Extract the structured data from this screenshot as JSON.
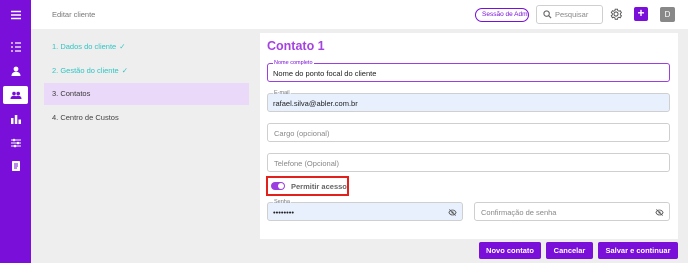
{
  "rail": {
    "items": [
      {
        "icon": "menu-icon"
      },
      {
        "icon": "list-icon"
      },
      {
        "icon": "user-icon"
      },
      {
        "icon": "users-icon",
        "active": true
      },
      {
        "icon": "bar-chart-icon"
      },
      {
        "icon": "sliders-icon"
      },
      {
        "icon": "document-icon"
      }
    ]
  },
  "header": {
    "breadcrumb": "Editar cliente",
    "session_badge": "Sessão de Admin",
    "search_placeholder": "Pesquisar",
    "add_label": "+",
    "avatar_initial": "D"
  },
  "steps": [
    {
      "label": "1. Dados do cliente",
      "check": "✓",
      "state": "done"
    },
    {
      "label": "2. Gestão do cliente",
      "check": "✓",
      "state": "done"
    },
    {
      "label": "3. Contatos",
      "check": "",
      "state": "active"
    },
    {
      "label": "4. Centro de Custos",
      "check": "",
      "state": "pending"
    }
  ],
  "form": {
    "title": "Contato 1",
    "name_field": {
      "label": "Nome completo",
      "value": "Nome do ponto focal do cliente"
    },
    "email_field": {
      "label": "E-mail",
      "value": "rafael.silva@abler.com.br"
    },
    "role_field": {
      "placeholder": "Cargo (opcional)"
    },
    "phone_field": {
      "placeholder": "Telefone (Opcional)"
    },
    "access_toggle": {
      "label": "Permitir acesso",
      "checked": true
    },
    "password_field": {
      "label": "Senha",
      "value": "••••••••"
    },
    "confirm_field": {
      "placeholder": "Confirmação de senha"
    }
  },
  "actions": {
    "new_contact": "Novo contato",
    "cancel": "Cancelar",
    "save_continue": "Salvar e continuar"
  },
  "colors": {
    "accent": "#7a0fd9",
    "title": "#a443e0",
    "done": "#2fc4c4",
    "highlight_border": "#e2201c"
  }
}
